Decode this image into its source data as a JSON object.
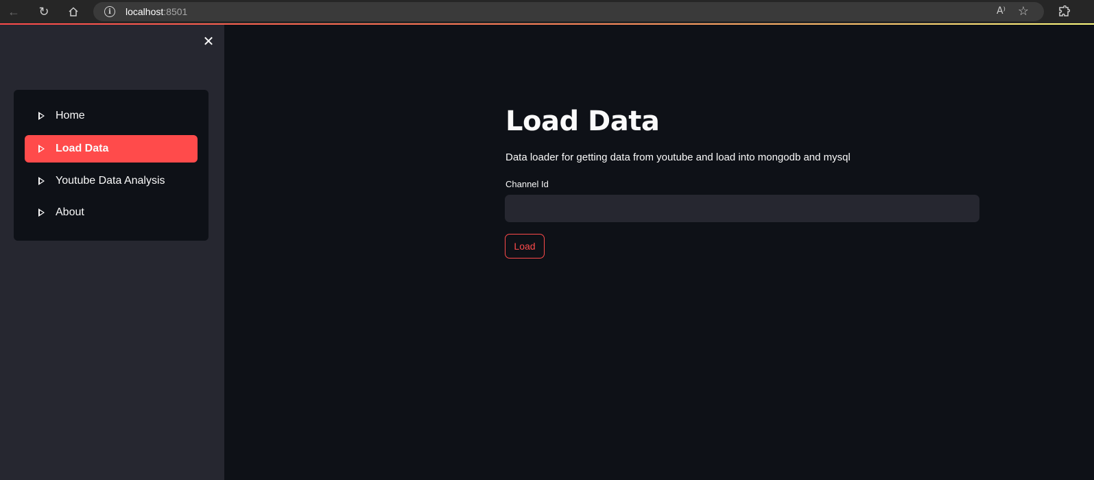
{
  "browser": {
    "url_host": "localhost",
    "url_port": ":8501",
    "read_aloud_label": "A⁾"
  },
  "sidebar": {
    "items": [
      {
        "label": "Home"
      },
      {
        "label": "Load Data"
      },
      {
        "label": "Youtube Data Analysis"
      },
      {
        "label": "About"
      }
    ],
    "active_index": 1,
    "close_glyph": "✕"
  },
  "main": {
    "title": "Load Data",
    "description": "Data loader for getting data from youtube and load into mongodb and mysql",
    "channel_label": "Channel Id",
    "channel_value": "",
    "load_label": "Load"
  },
  "colors": {
    "accent": "#ff4b4b",
    "background": "#0e1117",
    "sidebar": "#262730"
  }
}
